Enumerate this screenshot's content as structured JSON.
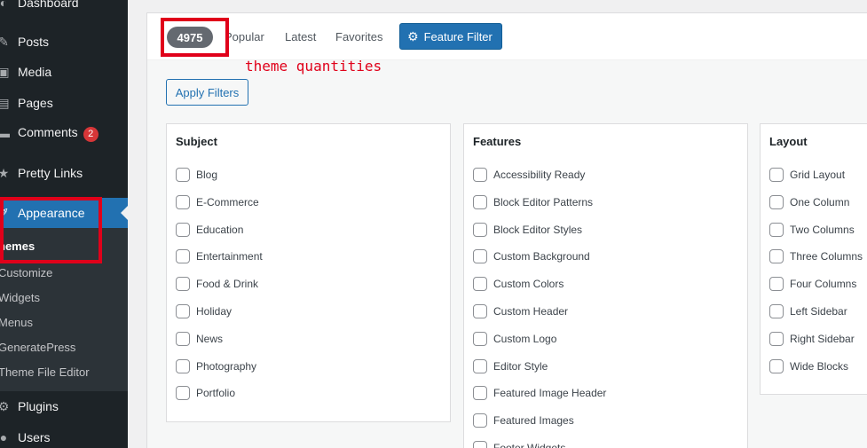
{
  "sidebar": {
    "items": [
      {
        "label": "Dashboard",
        "icon": "dashboard-icon"
      },
      {
        "label": "Posts",
        "icon": "pin-icon"
      },
      {
        "label": "Media",
        "icon": "media-icon"
      },
      {
        "label": "Pages",
        "icon": "pages-icon"
      },
      {
        "label": "Comments",
        "icon": "comments-icon",
        "badge": "2"
      },
      {
        "label": "Pretty Links",
        "icon": "star-icon"
      },
      {
        "label": "Appearance",
        "icon": "paintbrush-icon"
      },
      {
        "label": "Plugins",
        "icon": "plugin-icon"
      },
      {
        "label": "Users",
        "icon": "users-icon"
      }
    ],
    "submenu": [
      "hemes",
      "Customize",
      "Widgets",
      "Menus",
      "GeneratePress",
      "Theme File Editor"
    ]
  },
  "filter_bar": {
    "count": "4975",
    "links": [
      "Popular",
      "Latest",
      "Favorites"
    ],
    "feature_filter": "Feature Filter"
  },
  "annotation": "theme quantities",
  "apply_filters": "Apply Filters",
  "panels": [
    {
      "title": "Subject",
      "options": [
        "Blog",
        "E-Commerce",
        "Education",
        "Entertainment",
        "Food & Drink",
        "Holiday",
        "News",
        "Photography",
        "Portfolio"
      ]
    },
    {
      "title": "Features",
      "options": [
        "Accessibility Ready",
        "Block Editor Patterns",
        "Block Editor Styles",
        "Custom Background",
        "Custom Colors",
        "Custom Header",
        "Custom Logo",
        "Editor Style",
        "Featured Image Header",
        "Featured Images",
        "Footer Widgets"
      ]
    },
    {
      "title": "Layout",
      "options": [
        "Grid Layout",
        "One Column",
        "Two Columns",
        "Three Columns",
        "Four Columns",
        "Left Sidebar",
        "Right Sidebar",
        "Wide Blocks"
      ]
    }
  ],
  "colors": {
    "accent": "#2271b1",
    "sidebar": "#1d2327",
    "annotation": "#e0001a",
    "badge": "#d63638"
  }
}
